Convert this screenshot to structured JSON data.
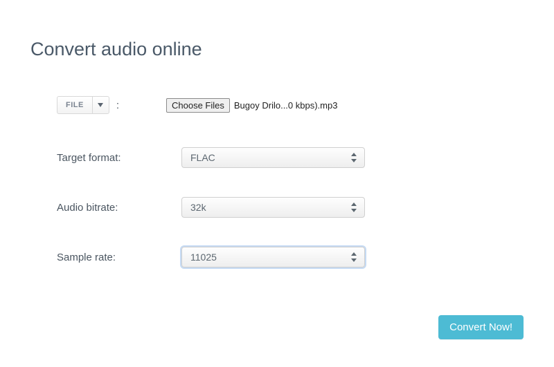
{
  "title": "Convert audio online",
  "file": {
    "button_label": "FILE",
    "colon": ":",
    "choose_label": "Choose Files",
    "chosen_name": "Bugoy Drilo...0 kbps).mp3"
  },
  "fields": {
    "target_format": {
      "label": "Target format:",
      "value": "FLAC"
    },
    "audio_bitrate": {
      "label": "Audio bitrate:",
      "value": "32k"
    },
    "sample_rate": {
      "label": "Sample rate:",
      "value": "11025"
    }
  },
  "convert_button": "Convert Now!"
}
